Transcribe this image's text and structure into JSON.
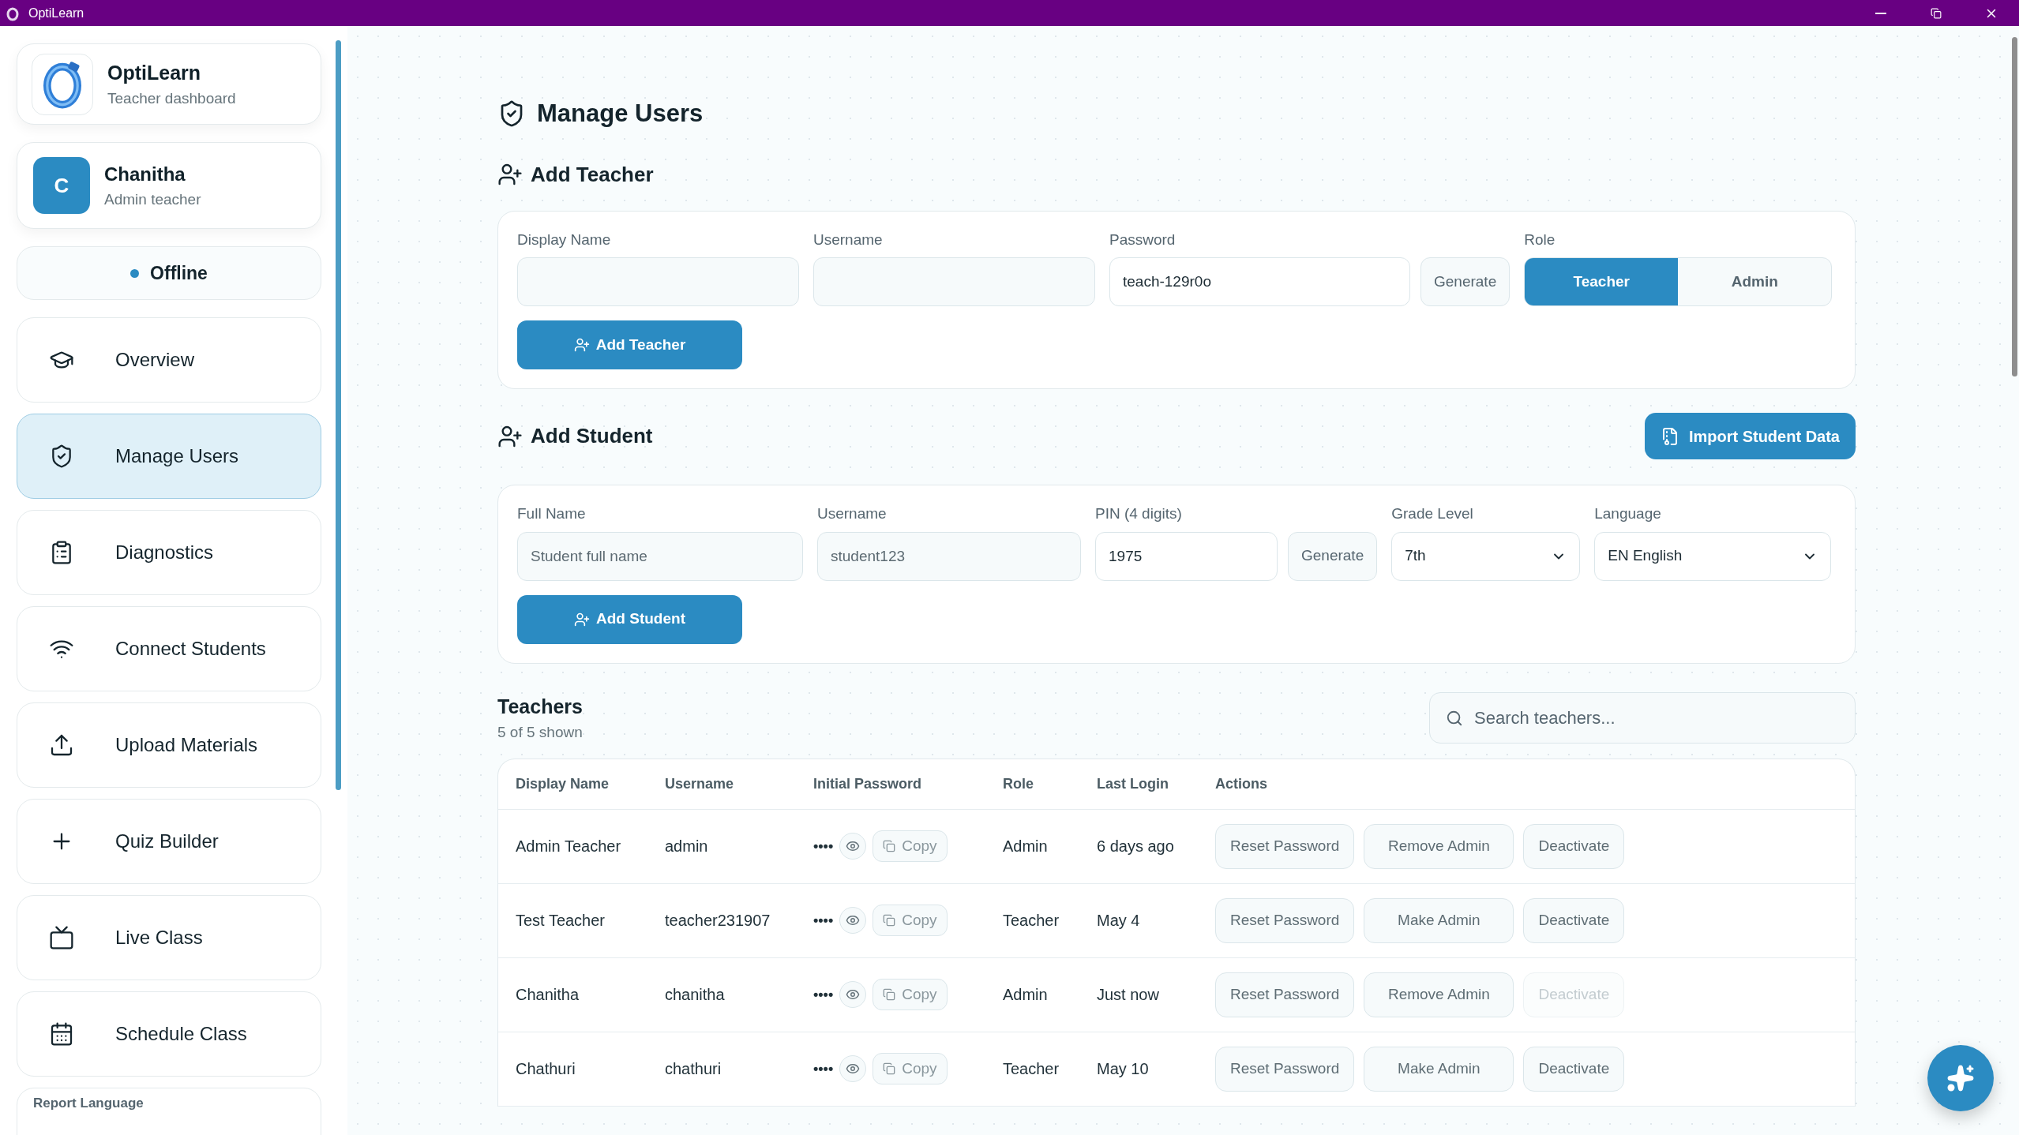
{
  "window": {
    "title": "OptiLearn"
  },
  "sidebar": {
    "brand": {
      "name": "OptiLearn",
      "subtitle": "Teacher dashboard"
    },
    "user": {
      "initial": "C",
      "name": "Chanitha",
      "role": "Admin teacher"
    },
    "status": {
      "label": "Offline"
    },
    "nav": [
      {
        "label": "Overview",
        "selected": false
      },
      {
        "label": "Manage Users",
        "selected": true
      },
      {
        "label": "Diagnostics",
        "selected": false
      },
      {
        "label": "Connect Students",
        "selected": false
      },
      {
        "label": "Upload Materials",
        "selected": false
      },
      {
        "label": "Quiz Builder",
        "selected": false
      },
      {
        "label": "Live Class",
        "selected": false
      },
      {
        "label": "Schedule Class",
        "selected": false
      }
    ],
    "footer_card": {
      "label": "Report Language"
    }
  },
  "page_title": "Manage Users",
  "add_teacher": {
    "title": "Add Teacher",
    "fields": [
      {
        "kind": "text",
        "label": "Display Name"
      },
      {
        "kind": "text",
        "label": "Username"
      },
      {
        "kind": "generate",
        "label": "Password",
        "value": "teach-129r0o",
        "button": "Generate"
      },
      {
        "kind": "segmented",
        "label": "Role",
        "options": [
          {
            "label": "Teacher",
            "selected": true
          },
          {
            "label": "Admin",
            "selected": false
          }
        ]
      }
    ],
    "submit": "Add Teacher"
  },
  "add_student": {
    "title": "Add Student",
    "import_button": "Import Student Data",
    "fields": [
      {
        "kind": "text",
        "label": "Full Name",
        "placeholder": "Student full name"
      },
      {
        "kind": "text",
        "label": "Username",
        "placeholder": "student123"
      },
      {
        "kind": "generate",
        "label": "PIN (4 digits)",
        "value": "1975",
        "button": "Generate"
      },
      {
        "kind": "select",
        "label": "Grade Level",
        "value": "7th"
      },
      {
        "kind": "select",
        "label": "Language",
        "value": "EN English"
      }
    ],
    "submit": "Add Student"
  },
  "teachers": {
    "title": "Teachers",
    "count": "5 of 5 shown",
    "search_placeholder": "Search teachers...",
    "columns": [
      "Display Name",
      "Username",
      "Initial Password",
      "Role",
      "Last Login",
      "Actions"
    ],
    "rows": [
      {
        "display_name": "Admin Teacher",
        "username": "admin",
        "password": "••••",
        "copy": "Copy",
        "role": "Admin",
        "last_login": "6 days ago",
        "actions": [
          {
            "label": "Reset Password",
            "disabled": false
          },
          {
            "label": "Remove Admin",
            "disabled": false
          },
          {
            "label": "Deactivate",
            "disabled": false
          }
        ]
      },
      {
        "display_name": "Test Teacher",
        "username": "teacher231907",
        "password": "••••",
        "copy": "Copy",
        "role": "Teacher",
        "last_login": "May 4",
        "actions": [
          {
            "label": "Reset Password",
            "disabled": false
          },
          {
            "label": "Make Admin",
            "disabled": false
          },
          {
            "label": "Deactivate",
            "disabled": false
          }
        ]
      },
      {
        "display_name": "Chanitha",
        "username": "chanitha",
        "password": "••••",
        "copy": "Copy",
        "role": "Admin",
        "last_login": "Just now",
        "actions": [
          {
            "label": "Reset Password",
            "disabled": false
          },
          {
            "label": "Remove Admin",
            "disabled": false
          },
          {
            "label": "Deactivate",
            "disabled": true
          }
        ]
      },
      {
        "display_name": "Chathuri",
        "username": "chathuri",
        "password": "••••",
        "copy": "Copy",
        "role": "Teacher",
        "last_login": "May 10",
        "actions": [
          {
            "label": "Reset Password",
            "disabled": false
          },
          {
            "label": "Make Admin",
            "disabled": false
          },
          {
            "label": "Deactivate",
            "disabled": false
          }
        ]
      }
    ]
  }
}
